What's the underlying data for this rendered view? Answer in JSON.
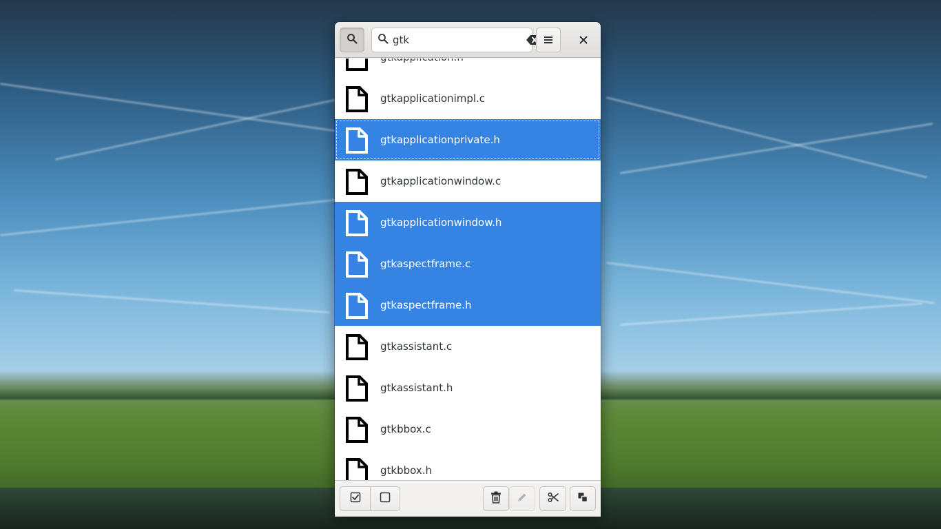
{
  "search": {
    "value": "gtk"
  },
  "file_list": [
    {
      "name": "gtkapplication.h",
      "selected": false,
      "partial": true
    },
    {
      "name": "gtkapplicationimpl.c",
      "selected": false
    },
    {
      "name": "gtkapplicationprivate.h",
      "selected": true,
      "focused": true
    },
    {
      "name": "gtkapplicationwindow.c",
      "selected": false
    },
    {
      "name": "gtkapplicationwindow.h",
      "selected": true
    },
    {
      "name": "gtkaspectframe.c",
      "selected": true
    },
    {
      "name": "gtkaspectframe.h",
      "selected": true
    },
    {
      "name": "gtkassistant.c",
      "selected": false
    },
    {
      "name": "gtkassistant.h",
      "selected": false
    },
    {
      "name": "gtkbbox.c",
      "selected": false
    },
    {
      "name": "gtkbbox.h",
      "selected": false
    }
  ],
  "icons": {
    "search_toggle": "search-icon",
    "search_entry": "search-icon",
    "clear": "clear-text-icon",
    "menu": "hamburger-menu-icon",
    "close": "close-icon",
    "file": "text-file-icon",
    "select_all": "checkbox-checked-icon",
    "select_none": "checkbox-empty-icon",
    "delete": "trash-icon",
    "rename": "pencil-icon",
    "cut": "scissors-icon",
    "copy": "copy-icon"
  },
  "colors": {
    "selection": "#3584e4",
    "headerbar": "#e8e6e3",
    "text": "#2e3436"
  }
}
